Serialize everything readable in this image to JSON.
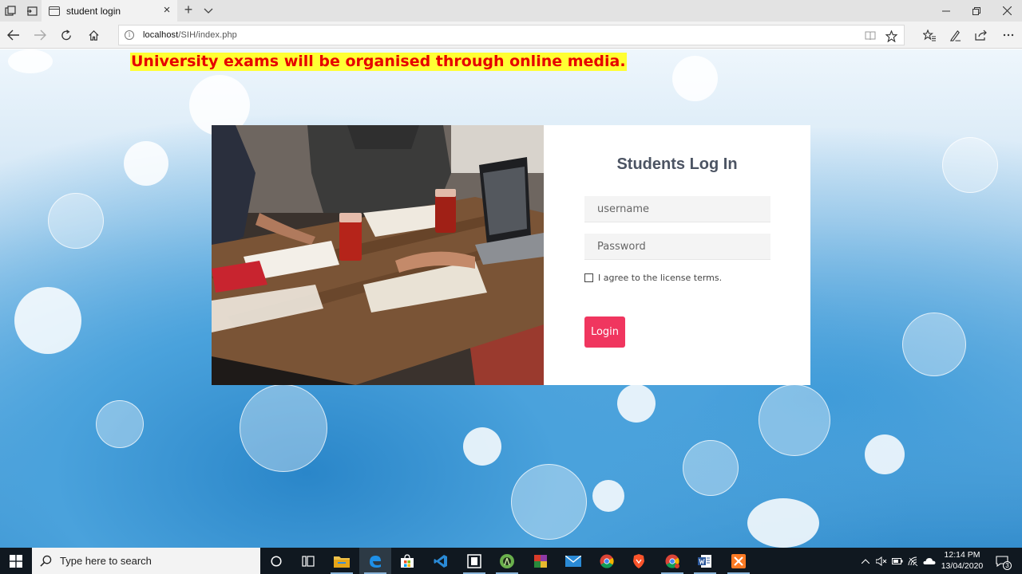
{
  "browser": {
    "tab_title": "student login",
    "url_host": "localhost",
    "url_path": "/SIH/index.php"
  },
  "page": {
    "announcement": "University exams will be organised through online media.",
    "login": {
      "title": "Students Log In",
      "username_placeholder": "username",
      "password_placeholder": "Password",
      "agree_text": "I agree to the license terms.",
      "login_label": "Login",
      "button_color": "#f0365f"
    }
  },
  "taskbar": {
    "search_placeholder": "Type here to search",
    "time": "12:14 PM",
    "date": "13/04/2020",
    "notification_count": "3",
    "apps": [
      "cortana-icon",
      "task-view-icon",
      "file-explorer-icon",
      "edge-icon",
      "store-icon",
      "vscode-icon",
      "app-icon",
      "android-studio-icon",
      "winrar-icon",
      "mail-icon",
      "chrome-icon",
      "brave-icon",
      "chrome-alt-icon",
      "word-icon",
      "xampp-icon"
    ]
  }
}
